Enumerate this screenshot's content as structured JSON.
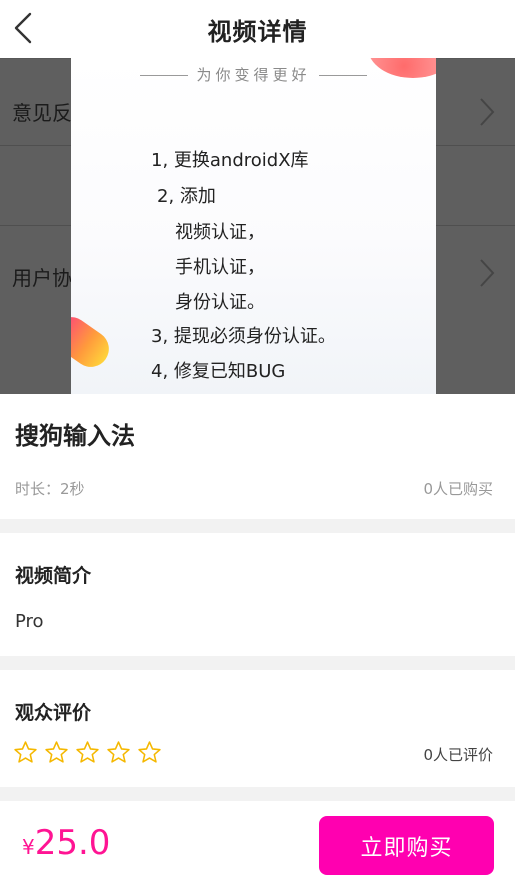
{
  "header": {
    "title": "视频详情"
  },
  "background_list": {
    "items": [
      "意见反",
      "用户协"
    ]
  },
  "video": {
    "slogan": "为你变得更好",
    "notes": [
      "1, 更换androidX库",
      "2, 添加",
      "视频认证，",
      "手机认证，",
      "身份认证。",
      "3, 提现必须身份认证。",
      "4, 修复已知BUG"
    ]
  },
  "info": {
    "name": "搜狗输入法",
    "duration": "时长：2秒",
    "buyers": "0人已购买"
  },
  "intro": {
    "title": "视频简介",
    "text": "Pro"
  },
  "review": {
    "title": "观众评价",
    "rating": 0,
    "max_rating": 5,
    "count": "0人已评价"
  },
  "footer": {
    "price_symbol": "¥",
    "price": "25.0",
    "buy_label": "立即购买"
  },
  "colors": {
    "accent": "#ff00b0",
    "price": "#ff1493"
  }
}
